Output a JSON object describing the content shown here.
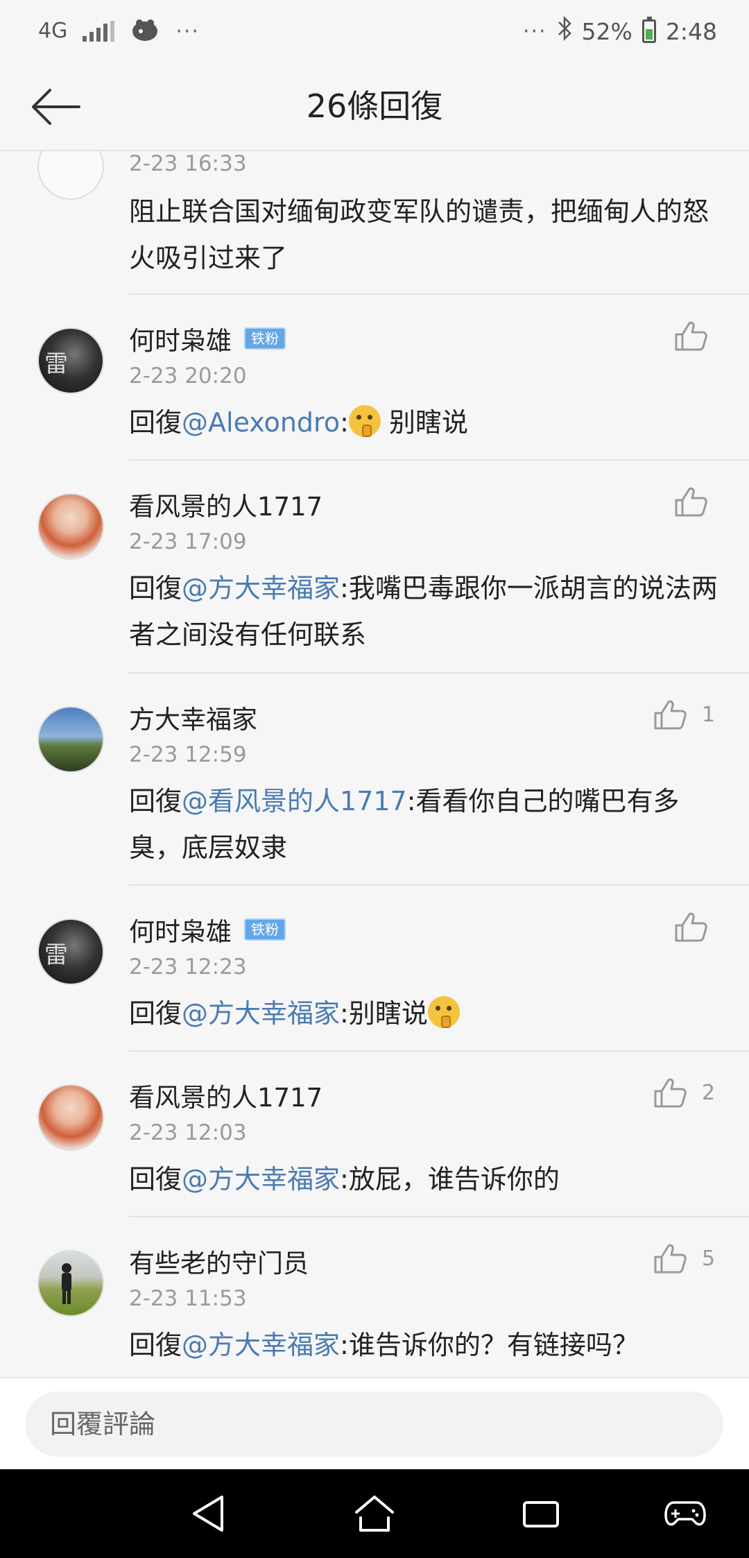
{
  "status_bar": {
    "network": "4G",
    "left_more": "···",
    "right_more": "···",
    "battery": "52%",
    "time": "2:48"
  },
  "header": {
    "title": "26條回復"
  },
  "comments": [
    {
      "timestamp": "2-23 16:33",
      "text": "阻止联合国对缅甸政变军队的谴责，把缅甸人的怒火吸引过来了"
    },
    {
      "username": "何时枭雄",
      "badge": "铁粉",
      "timestamp": "2-23 20:20",
      "reply_prefix": "回復",
      "mention": "@Alexondro",
      "text": ": 别瞎说",
      "likes": ""
    },
    {
      "username": "看风景的人1717",
      "timestamp": "2-23 17:09",
      "reply_prefix": "回復",
      "mention": "@方大幸福家",
      "text": ":我嘴巴毒跟你一派胡言的说法两者之间没有任何联系",
      "likes": ""
    },
    {
      "username": "方大幸福家",
      "timestamp": "2-23 12:59",
      "reply_prefix": "回復",
      "mention": "@看风景的人1717",
      "text": ":看看你自己的嘴巴有多臭，底层奴隶",
      "likes": "1"
    },
    {
      "username": "何时枭雄",
      "badge": "铁粉",
      "timestamp": "2-23 12:23",
      "reply_prefix": "回復",
      "mention": "@方大幸福家",
      "text": ":别瞎说",
      "likes": ""
    },
    {
      "username": "看风景的人1717",
      "timestamp": "2-23 12:03",
      "reply_prefix": "回復",
      "mention": "@方大幸福家",
      "text": ":放屁，谁告诉你的",
      "likes": "2"
    },
    {
      "username": "有些老的守门员",
      "timestamp": "2-23 11:53",
      "reply_prefix": "回復",
      "mention": "@方大幸福家",
      "text": ":谁告诉你的？有链接吗？",
      "likes": "5"
    }
  ],
  "reply_bar": {
    "placeholder": "回覆評論"
  },
  "icons": {
    "back": "arrow-left-icon",
    "like": "thumbs-up-icon",
    "emoji": "shushing-face-emoji",
    "nav_back": "triangle-back-icon",
    "nav_home": "home-icon",
    "nav_recent": "recent-apps-icon",
    "nav_game": "gamepad-icon"
  },
  "colors": {
    "mention": "#4a7bb3",
    "timestamp": "#9a9a9a",
    "badge": "#62a7e8",
    "background": "#f6f6f6"
  }
}
